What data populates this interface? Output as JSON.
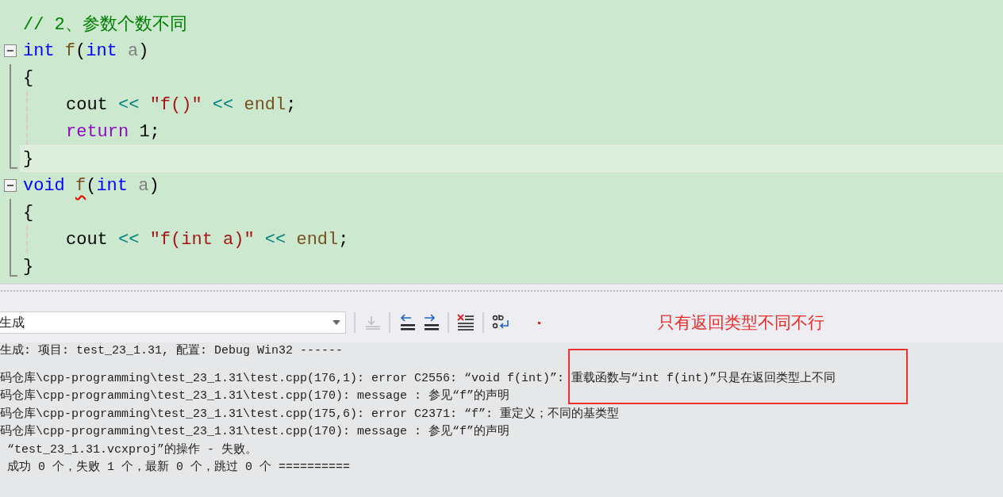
{
  "editor": {
    "lines": [
      {
        "kind": "plain",
        "indented": false,
        "current": false,
        "tokens": [
          {
            "kind": "comment",
            "text": "// 2、参数个数不同",
            "squiggle": false
          }
        ]
      },
      {
        "kind": "fold",
        "indented": false,
        "current": false,
        "tokens": [
          {
            "kind": "keyword",
            "text": "int ",
            "squiggle": false
          },
          {
            "kind": "func",
            "text": "f",
            "squiggle": false
          },
          {
            "kind": "plain",
            "text": "(",
            "squiggle": false
          },
          {
            "kind": "keyword",
            "text": "int",
            "squiggle": false
          },
          {
            "kind": "param",
            "text": " a",
            "squiggle": false
          },
          {
            "kind": "plain",
            "text": ")",
            "squiggle": false
          }
        ]
      },
      {
        "kind": "bar",
        "indented": false,
        "current": false,
        "tokens": [
          {
            "kind": "plain",
            "text": "{",
            "squiggle": false
          }
        ]
      },
      {
        "kind": "bar",
        "indented": true,
        "current": false,
        "tokens": [
          {
            "kind": "plain",
            "text": "cout ",
            "squiggle": false
          },
          {
            "kind": "op",
            "text": "<< ",
            "squiggle": false
          },
          {
            "kind": "string",
            "text": "\"f()\" ",
            "squiggle": false
          },
          {
            "kind": "op",
            "text": "<< ",
            "squiggle": false
          },
          {
            "kind": "func",
            "text": "endl",
            "squiggle": false
          },
          {
            "kind": "plain",
            "text": ";",
            "squiggle": false
          }
        ]
      },
      {
        "kind": "bar",
        "indented": true,
        "current": false,
        "tokens": [
          {
            "kind": "control",
            "text": "return",
            "squiggle": false
          },
          {
            "kind": "plain",
            "text": " 1;",
            "squiggle": false
          }
        ]
      },
      {
        "kind": "end",
        "indented": false,
        "current": true,
        "tokens": [
          {
            "kind": "plain",
            "text": "}",
            "squiggle": false
          }
        ]
      },
      {
        "kind": "fold",
        "indented": false,
        "current": false,
        "tokens": [
          {
            "kind": "keyword",
            "text": "void ",
            "squiggle": false
          },
          {
            "kind": "func",
            "text": "f",
            "squiggle": true
          },
          {
            "kind": "plain",
            "text": "(",
            "squiggle": false
          },
          {
            "kind": "keyword",
            "text": "int",
            "squiggle": false
          },
          {
            "kind": "param",
            "text": " a",
            "squiggle": false
          },
          {
            "kind": "plain",
            "text": ")",
            "squiggle": false
          }
        ]
      },
      {
        "kind": "bar",
        "indented": false,
        "current": false,
        "tokens": [
          {
            "kind": "plain",
            "text": "{",
            "squiggle": false
          }
        ]
      },
      {
        "kind": "bar",
        "indented": true,
        "current": false,
        "tokens": [
          {
            "kind": "plain",
            "text": "cout ",
            "squiggle": false
          },
          {
            "kind": "op",
            "text": "<< ",
            "squiggle": false
          },
          {
            "kind": "string",
            "text": "\"f(int a)\" ",
            "squiggle": false
          },
          {
            "kind": "op",
            "text": "<< ",
            "squiggle": false
          },
          {
            "kind": "func",
            "text": "endl",
            "squiggle": false
          },
          {
            "kind": "plain",
            "text": ";",
            "squiggle": false
          }
        ]
      },
      {
        "kind": "end",
        "indented": false,
        "current": false,
        "tokens": [
          {
            "kind": "plain",
            "text": "}",
            "squiggle": false
          }
        ]
      }
    ]
  },
  "output": {
    "source": "生成",
    "annotation": "只有返回类型不同不行",
    "lines": [
      {
        "text": "生成: 项目: test_23_1.31, 配置: Debug Win32 ------"
      },
      {
        "text": "码仓库\\cpp-programming\\test_23_1.31\\test.cpp(176,1): error C2556: “void f(int)”: 重载函数与“int f(int)”只是在返回类型上不同"
      },
      {
        "text": "码仓库\\cpp-programming\\test_23_1.31\\test.cpp(170): message : 参见“f”的声明"
      },
      {
        "text": "码仓库\\cpp-programming\\test_23_1.31\\test.cpp(175,6): error C2371: “f”: 重定义；不同的基类型"
      },
      {
        "text": "码仓库\\cpp-programming\\test_23_1.31\\test.cpp(170): message : 参见“f”的声明"
      },
      {
        "text": " “test_23_1.31.vcxproj”的操作 - 失败。"
      },
      {
        "text": " 成功 0 个，失败 1 个，最新 0 个，跳过 0 个 =========="
      }
    ]
  }
}
